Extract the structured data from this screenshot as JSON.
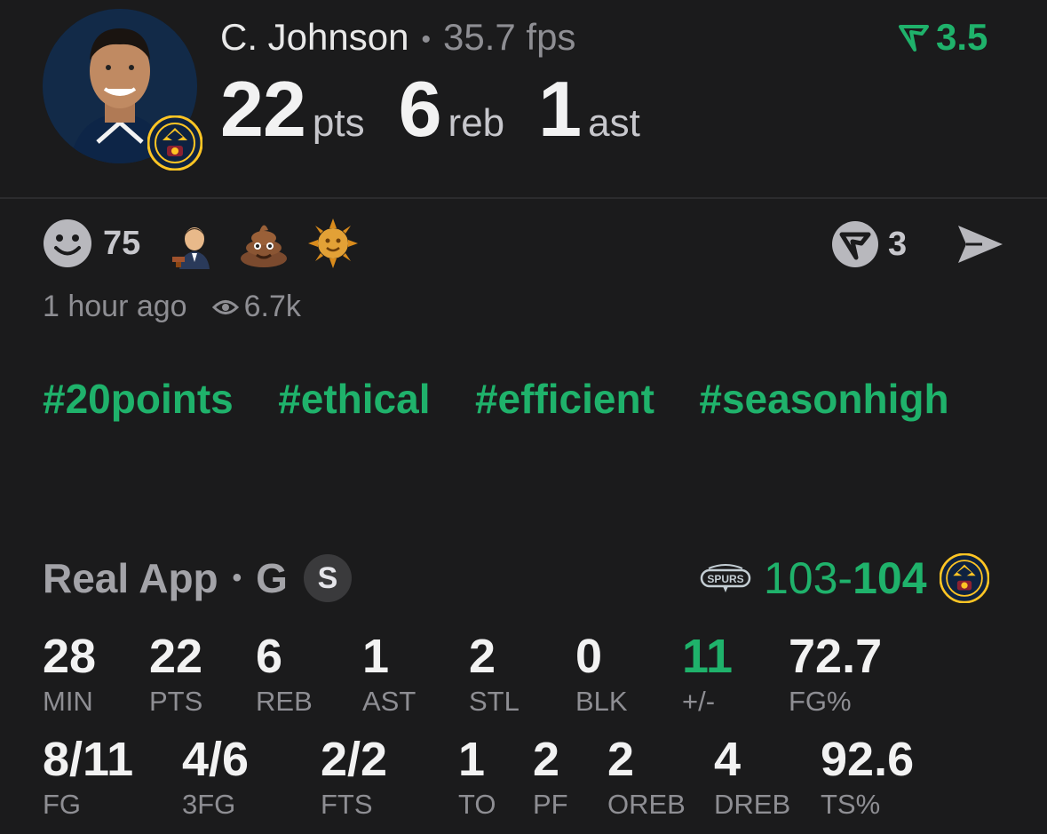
{
  "player": {
    "name": "C. Johnson",
    "fps": "35.7 fps",
    "boost": "3.5",
    "big_stats": [
      {
        "value": "22",
        "unit": "pts"
      },
      {
        "value": "6",
        "unit": "reb"
      },
      {
        "value": "1",
        "unit": "ast"
      }
    ]
  },
  "reactions": {
    "count": "75",
    "emoji_icons": [
      "judge-emoji-icon",
      "poop-emoji-icon",
      "sun-with-face-emoji-icon"
    ],
    "comments_count": "3"
  },
  "meta": {
    "time_ago": "1 hour ago",
    "views": "6.7k"
  },
  "tags": [
    "#20points",
    "#ethical",
    "#efficient",
    "#seasonhigh"
  ],
  "game": {
    "source": "Real App",
    "position": "G",
    "badge": "S",
    "score_away": "103-",
    "score_home": "104"
  },
  "stats_row1": [
    {
      "value": "28",
      "label": "MIN"
    },
    {
      "value": "22",
      "label": "PTS"
    },
    {
      "value": "6",
      "label": "REB"
    },
    {
      "value": "1",
      "label": "AST"
    },
    {
      "value": "2",
      "label": "STL"
    },
    {
      "value": "0",
      "label": "BLK"
    },
    {
      "value": "11",
      "label": "+/-"
    },
    {
      "value": "72.7",
      "label": "FG%"
    }
  ],
  "stats_row2": [
    {
      "value": "8/11",
      "label": "FG"
    },
    {
      "value": "4/6",
      "label": "3FG"
    },
    {
      "value": "2/2",
      "label": "FTS"
    },
    {
      "value": "1",
      "label": "TO"
    },
    {
      "value": "2",
      "label": "PF"
    },
    {
      "value": "2",
      "label": "OREB"
    },
    {
      "value": "4",
      "label": "DREB"
    },
    {
      "value": "92.6",
      "label": "TS%"
    }
  ],
  "colors": {
    "accent_green": "#1fb26b",
    "background": "#1b1b1c",
    "muted": "#8e8e93"
  }
}
